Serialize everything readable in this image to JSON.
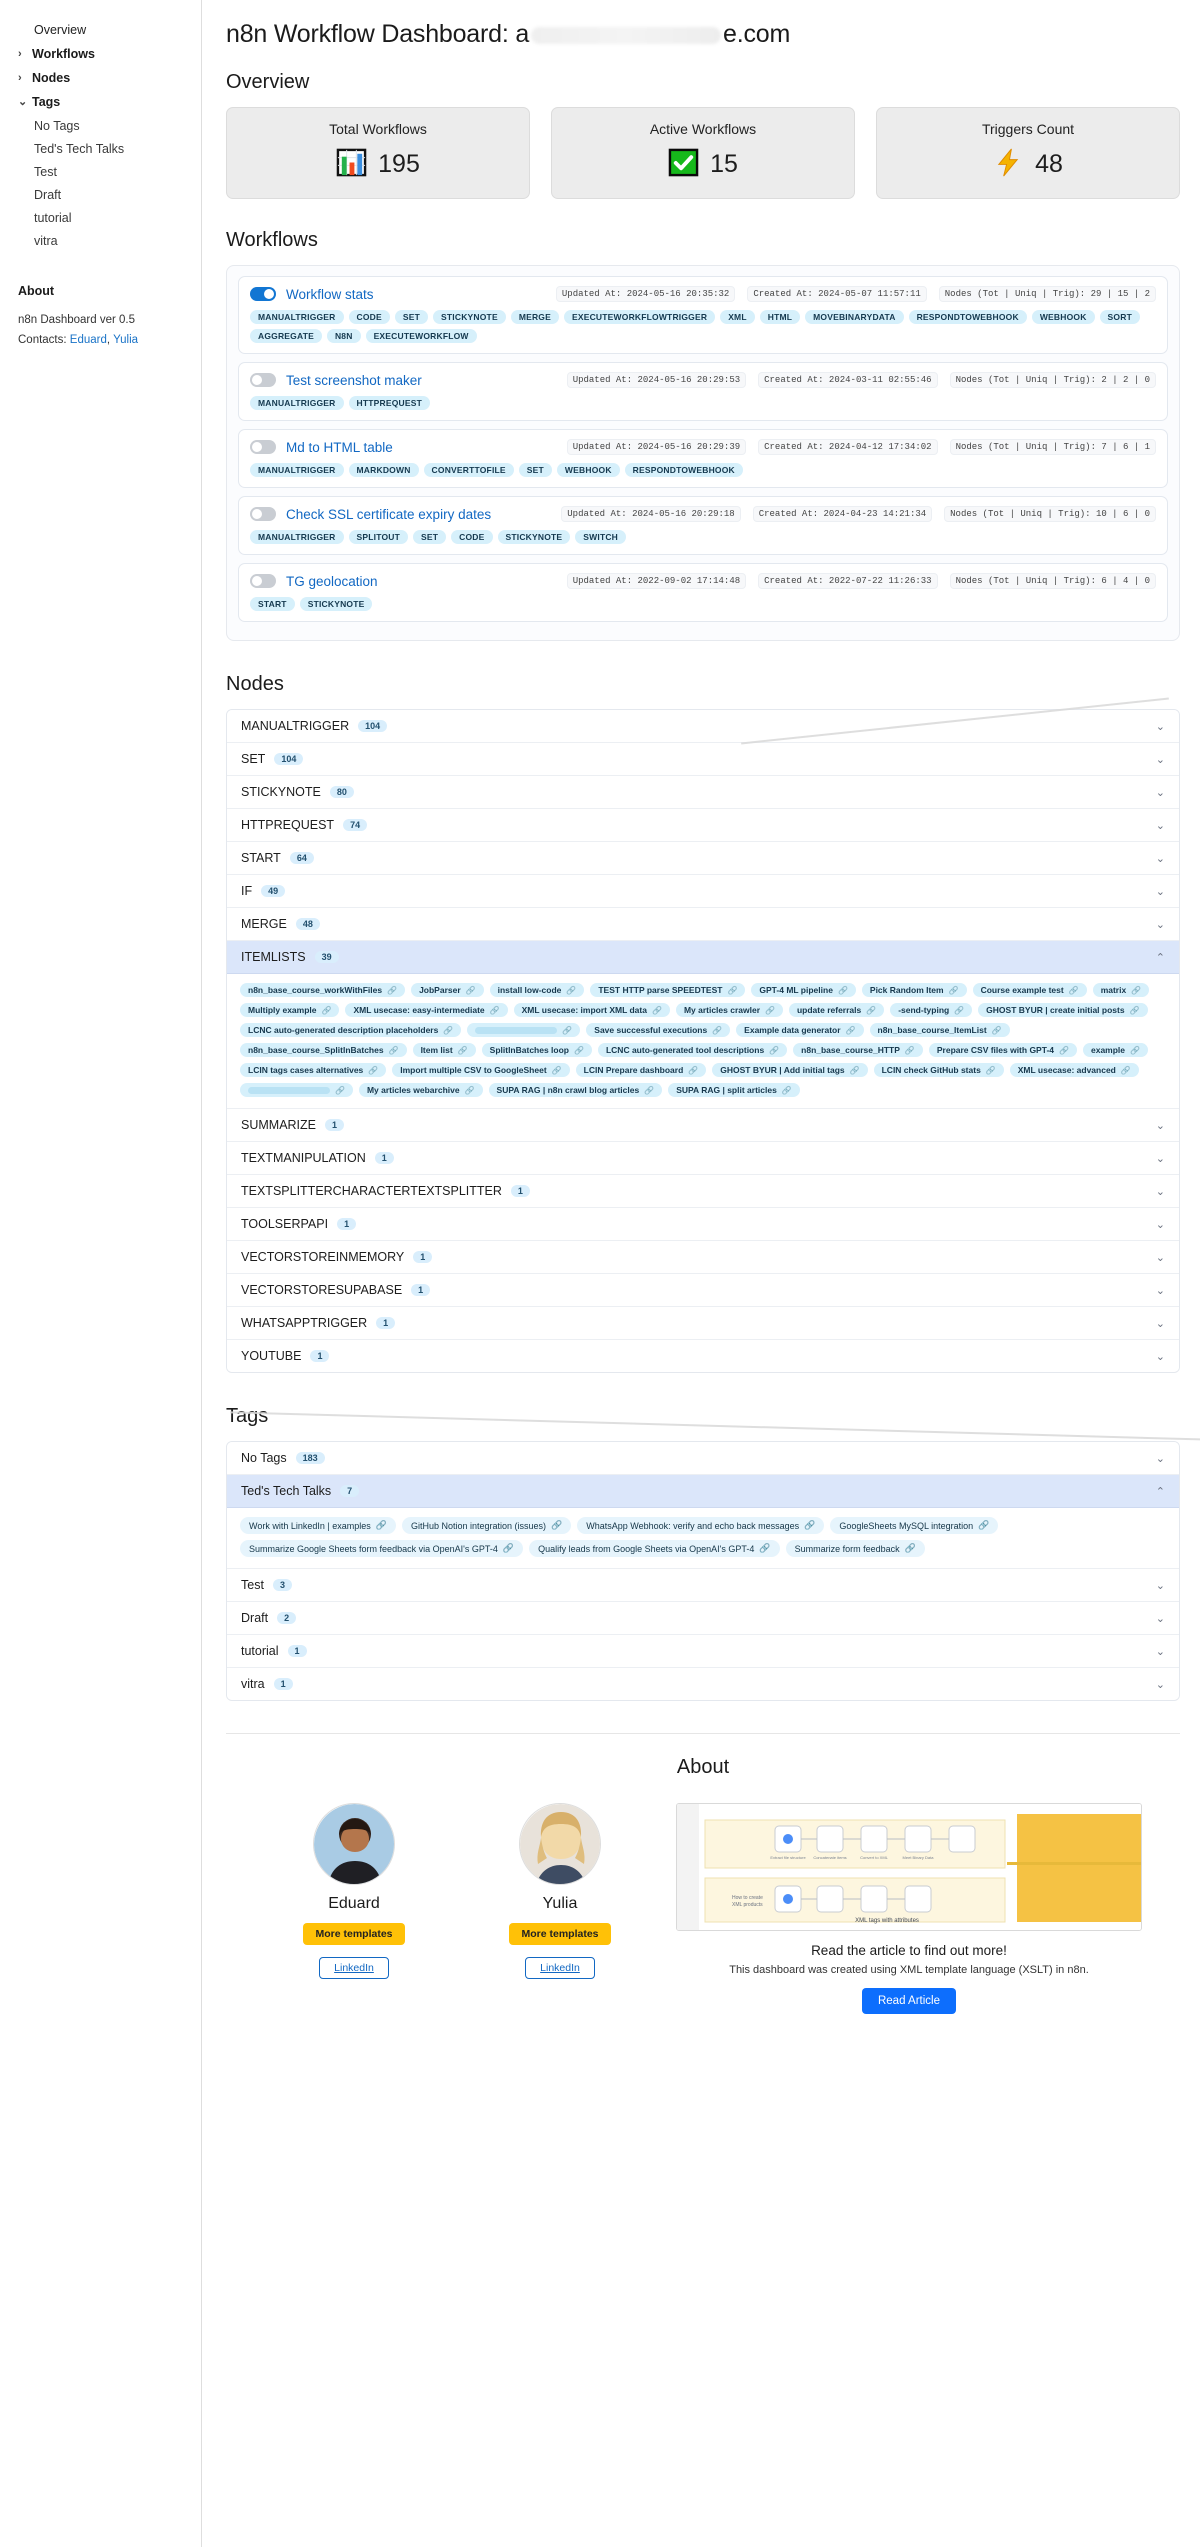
{
  "sidebar": {
    "items": [
      {
        "label": "Overview",
        "type": "top"
      },
      {
        "label": "Workflows",
        "type": "group",
        "chev": "›"
      },
      {
        "label": "Nodes",
        "type": "group",
        "chev": "›"
      },
      {
        "label": "Tags",
        "type": "group",
        "chev": "⌄"
      }
    ],
    "tags": [
      "No Tags",
      "Ted's Tech Talks",
      "Test",
      "Draft",
      "tutorial",
      "vitra"
    ],
    "about": {
      "heading": "About",
      "version": "n8n Dashboard ver 0.5",
      "contacts_label": "Contacts:",
      "contact1": "Eduard",
      "comma": ",",
      "contact2": "Yulia"
    }
  },
  "header": {
    "title_prefix": "n8n Workflow Dashboard: a",
    "title_suffix": "e.com"
  },
  "overview": {
    "heading": "Overview",
    "cards": [
      {
        "label": "Total Workflows",
        "value": "195",
        "icon": "bar-chart-icon"
      },
      {
        "label": "Active Workflows",
        "value": "15",
        "icon": "check-mark-icon"
      },
      {
        "label": "Triggers Count",
        "value": "48",
        "icon": "lightning-bolt-icon"
      }
    ]
  },
  "workflows": {
    "heading": "Workflows",
    "items": [
      {
        "name": "Workflow stats",
        "active": true,
        "updated": "Updated At: 2024-05-16 20:35:32",
        "created": "Created At: 2024-05-07 11:57:11",
        "nodes": "Nodes (Tot | Uniq | Trig): 29 | 15 | 2",
        "chips": [
          "MANUALTRIGGER",
          "CODE",
          "SET",
          "STICKYNOTE",
          "MERGE",
          "EXECUTEWORKFLOWTRIGGER",
          "XML",
          "HTML",
          "MOVEBINARYDATA",
          "RESPONDTOWEBHOOK",
          "WEBHOOK",
          "SORT",
          "AGGREGATE",
          "N8N",
          "EXECUTEWORKFLOW"
        ]
      },
      {
        "name": "Test screenshot maker",
        "active": false,
        "updated": "Updated At: 2024-05-16 20:29:53",
        "created": "Created At: 2024-03-11 02:55:46",
        "nodes": "Nodes (Tot | Uniq | Trig): 2 | 2 | 0",
        "chips": [
          "MANUALTRIGGER",
          "HTTPREQUEST"
        ]
      },
      {
        "name": "Md to HTML table",
        "active": false,
        "updated": "Updated At: 2024-05-16 20:29:39",
        "created": "Created At: 2024-04-12 17:34:02",
        "nodes": "Nodes (Tot | Uniq | Trig): 7 | 6 | 1",
        "chips": [
          "MANUALTRIGGER",
          "MARKDOWN",
          "CONVERTTOFILE",
          "SET",
          "WEBHOOK",
          "RESPONDTOWEBHOOK"
        ]
      },
      {
        "name": "Check SSL certificate expiry dates",
        "active": false,
        "updated": "Updated At: 2024-05-16 20:29:18",
        "created": "Created At: 2024-04-23 14:21:34",
        "nodes": "Nodes (Tot | Uniq | Trig): 10 | 6 | 0",
        "chips": [
          "MANUALTRIGGER",
          "SPLITOUT",
          "SET",
          "CODE",
          "STICKYNOTE",
          "SWITCH"
        ]
      },
      {
        "name": "TG geolocation",
        "active": false,
        "updated": "Updated At: 2022-09-02 17:14:48",
        "created": "Created At: 2022-07-22 11:26:33",
        "nodes": "Nodes (Tot | Uniq | Trig): 6 | 4 | 0",
        "chips": [
          "START",
          "STICKYNOTE"
        ]
      }
    ]
  },
  "nodes": {
    "heading": "Nodes",
    "rows": [
      {
        "label": "MANUALTRIGGER",
        "count": "104",
        "open": false
      },
      {
        "label": "SET",
        "count": "104",
        "open": false
      },
      {
        "label": "STICKYNOTE",
        "count": "80",
        "open": false
      },
      {
        "label": "HTTPREQUEST",
        "count": "74",
        "open": false
      },
      {
        "label": "START",
        "count": "64",
        "open": false
      },
      {
        "label": "IF",
        "count": "49",
        "open": false
      },
      {
        "label": "MERGE",
        "count": "48",
        "open": false
      },
      {
        "label": "ITEMLISTS",
        "count": "39",
        "open": true
      },
      {
        "label": "SUMMARIZE",
        "count": "1",
        "open": false
      },
      {
        "label": "TEXTMANIPULATION",
        "count": "1",
        "open": false
      },
      {
        "label": "TEXTSPLITTERCHARACTERTEXTSPLITTER",
        "count": "1",
        "open": false
      },
      {
        "label": "TOOLSERPAPI",
        "count": "1",
        "open": false
      },
      {
        "label": "VECTORSTOREINMEMORY",
        "count": "1",
        "open": false
      },
      {
        "label": "VECTORSTORESUPABASE",
        "count": "1",
        "open": false
      },
      {
        "label": "WHATSAPPTRIGGER",
        "count": "1",
        "open": false
      },
      {
        "label": "YOUTUBE",
        "count": "1",
        "open": false
      }
    ],
    "itemlists_links": [
      "n8n_base_course_workWithFiles",
      "JobParser",
      "install low-code",
      "TEST HTTP parse SPEEDTEST",
      "GPT-4 ML pipeline",
      "Pick Random Item",
      "Course example test",
      "matrix",
      "Multiply example",
      "XML usecase: easy-intermediate",
      "XML usecase: import XML data",
      "My articles crawler",
      "update referrals",
      "-send-typing",
      "GHOST BYUR | create initial posts",
      "LCNC auto-generated description placeholders",
      "__BLANK__",
      "Save successful executions",
      "Example data generator",
      "n8n_base_course_ItemList",
      "n8n_base_course_SplitInBatches",
      "Item list",
      "SplitInBatches loop",
      "LCNC auto-generated tool descriptions",
      "n8n_base_course_HTTP",
      "Prepare CSV files with GPT-4",
      "example",
      "LCIN tags cases alternatives",
      "Import multiple CSV to GoogleSheet",
      "LCIN Prepare dashboard",
      "GHOST BYUR | Add initial tags",
      "LCIN check GitHub stats",
      "XML usecase: advanced",
      "__BLANK__",
      "My articles webarchive",
      "SUPA RAG | n8n crawl blog articles",
      "SUPA RAG | split articles"
    ]
  },
  "tags": {
    "heading": "Tags",
    "rows": [
      {
        "label": "No Tags",
        "count": "183",
        "open": false
      },
      {
        "label": "Ted's Tech Talks",
        "count": "7",
        "open": true
      },
      {
        "label": "Test",
        "count": "3",
        "open": false
      },
      {
        "label": "Draft",
        "count": "2",
        "open": false
      },
      {
        "label": "tutorial",
        "count": "1",
        "open": false
      },
      {
        "label": "vitra",
        "count": "1",
        "open": false
      }
    ],
    "ted_links": [
      "Work with LinkedIn | examples",
      "GitHub Notion integration (issues)",
      "WhatsApp Webhook: verify and echo back messages",
      "GoogleSheets MySQL integration",
      "Summarize Google Sheets form feedback via OpenAI's GPT-4",
      "Qualify leads from Google Sheets via OpenAI's GPT-4",
      "Summarize form feedback"
    ]
  },
  "about": {
    "heading": "About",
    "people": [
      {
        "name": "Eduard",
        "button": "More templates",
        "link": "LinkedIn",
        "avatar": "eduard-avatar"
      },
      {
        "name": "Yulia",
        "button": "More templates",
        "link": "LinkedIn",
        "avatar": "yulia-avatar"
      }
    ],
    "promo": {
      "title": "Read the article to find out more!",
      "subtitle": "This dashboard was created using XML template language (XSLT) in n8n.",
      "button": "Read Article",
      "image": "workflow-diagram-screenshot"
    }
  },
  "colors": {
    "accent": "#1268c3",
    "chip_bg": "#d6f0fb",
    "open_row_bg": "#dbe6fa",
    "yellow": "#ffc107",
    "blue_button": "#0d6efd"
  }
}
